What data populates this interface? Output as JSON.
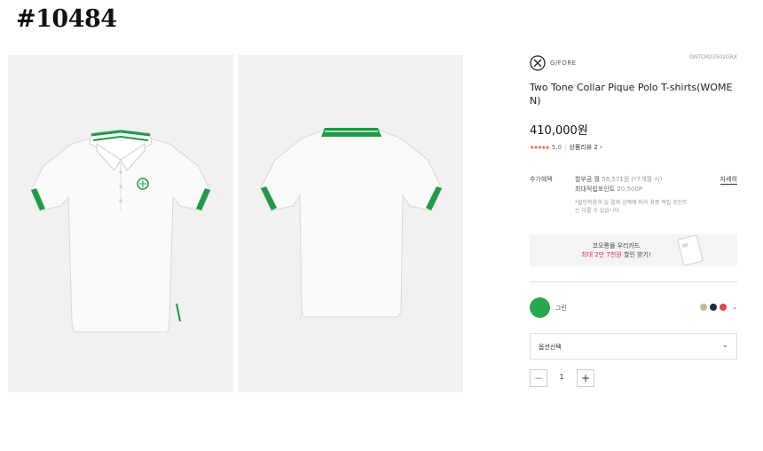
{
  "corner_tag": "#10484",
  "brand": {
    "name": "G/FORE",
    "sku": "GNTCM23502GRX"
  },
  "product": {
    "title": "Two Tone Collar Pique Polo T-shirts(WOMEN)",
    "price": "410,000원",
    "stars": "★★★★★",
    "rating": "5.0",
    "review_link": "상품리뷰 2 ›"
  },
  "benefit": {
    "label": "추가혜택",
    "installment": "할부금 월",
    "installment_value": "58,571원 (*7개월 시)",
    "points_label": "최대적립포인트",
    "points_value": "20,500P",
    "note": "*할인적용과 실 결제 금액에 따라 최종 적립 포인트는 다를 수 있습니다.",
    "detail": "자세히"
  },
  "card_banner": {
    "line1": "코오롱몰 우리카드",
    "line2_highlight": "최대 2만 7천원",
    "line2_rest": " 할인 받기!"
  },
  "color": {
    "selected_name": "그린",
    "selected_hex": "#27a84a",
    "swatches": [
      "#c8b79a",
      "#1f2a44",
      "#e04848"
    ],
    "expand_icon": "chevron-down-icon"
  },
  "option": {
    "label": "옵션선택"
  },
  "quantity": {
    "minus": "−",
    "value": "1",
    "plus": "+"
  }
}
